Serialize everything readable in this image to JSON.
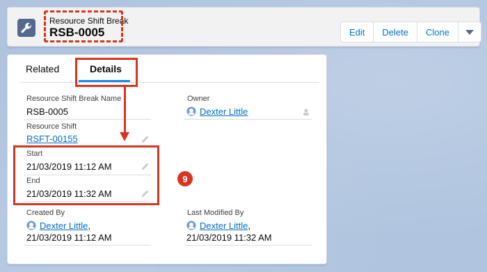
{
  "header": {
    "object_type": "Resource Shift Break",
    "record_name": "RSB-0005",
    "actions": [
      "Edit",
      "Delete",
      "Clone"
    ]
  },
  "tabs": [
    "Related",
    "Details"
  ],
  "active_tab": "Details",
  "fields": {
    "name": {
      "label": "Resource Shift Break Name",
      "value": "RSB-0005"
    },
    "owner": {
      "label": "Owner",
      "value": "Dexter Little"
    },
    "resource_shift": {
      "label": "Resource Shift",
      "value": "RSFT-00155"
    },
    "start": {
      "label": "Start",
      "value": "21/03/2019 11:12 AM"
    },
    "end": {
      "label": "End",
      "value": "21/03/2019 11:32 AM"
    },
    "created_by": {
      "label": "Created By",
      "user": "Dexter Little",
      "separator": ",",
      "date": "21/03/2019 11:12 AM"
    },
    "last_modified_by": {
      "label": "Last Modified By",
      "user": "Dexter Little",
      "separator": ",",
      "date": "21/03/2019 11:32 AM"
    }
  },
  "annotation": {
    "step_number": "9"
  },
  "colors": {
    "highlight": "#d9341f",
    "link": "#006dcc",
    "icon_bg": "#54698d",
    "tab_active": "#1589ee"
  },
  "icons": {
    "object": "wrench-icon",
    "menu": "chevron-down-icon",
    "edit": "pencil-icon",
    "user": "user-avatar-icon",
    "owner_change": "change-owner-icon"
  }
}
